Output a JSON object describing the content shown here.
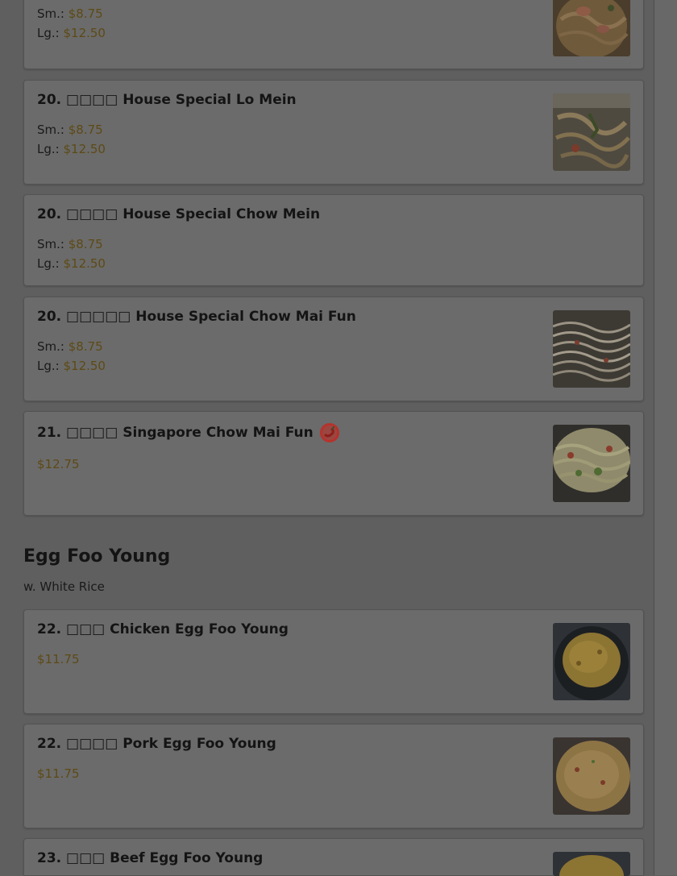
{
  "menu": {
    "items": [
      {
        "id": "item0",
        "sm_label": "Sm.:",
        "sm_price": "$8.75",
        "lg_label": "Lg.:",
        "lg_price": "$12.50"
      },
      {
        "id": "item1",
        "title": "20. □□□□ House Special Lo Mein",
        "sm_label": "Sm.:",
        "sm_price": "$8.75",
        "lg_label": "Lg.:",
        "lg_price": "$12.50"
      },
      {
        "id": "item2",
        "title": "20. □□□□ House Special Chow Mein",
        "sm_label": "Sm.:",
        "sm_price": "$8.75",
        "lg_label": "Lg.:",
        "lg_price": "$12.50"
      },
      {
        "id": "item3",
        "title": "20. □□□□□ House Special Chow Mai Fun",
        "sm_label": "Sm.:",
        "sm_price": "$8.75",
        "lg_label": "Lg.:",
        "lg_price": "$12.50"
      },
      {
        "id": "item4",
        "title": "21. □□□□ Singapore Chow Mai Fun",
        "price": "$12.75",
        "spicy_icon": "chili-pepper-icon"
      }
    ],
    "section": {
      "title": "Egg Foo Young",
      "subtitle": "w. White Rice",
      "items": [
        {
          "id": "item5",
          "title": "22. □□□ Chicken Egg Foo Young",
          "price": "$11.75"
        },
        {
          "id": "item6",
          "title": "22. □□□□ Pork Egg Foo Young",
          "price": "$11.75"
        },
        {
          "id": "item7",
          "title": "23. □□□ Beef Egg Foo Young"
        }
      ]
    }
  },
  "colors": {
    "overlay": "#5f5f5f",
    "card": "#6b6b6b",
    "price": "#5d4a15",
    "spicy": "#b5332c"
  }
}
